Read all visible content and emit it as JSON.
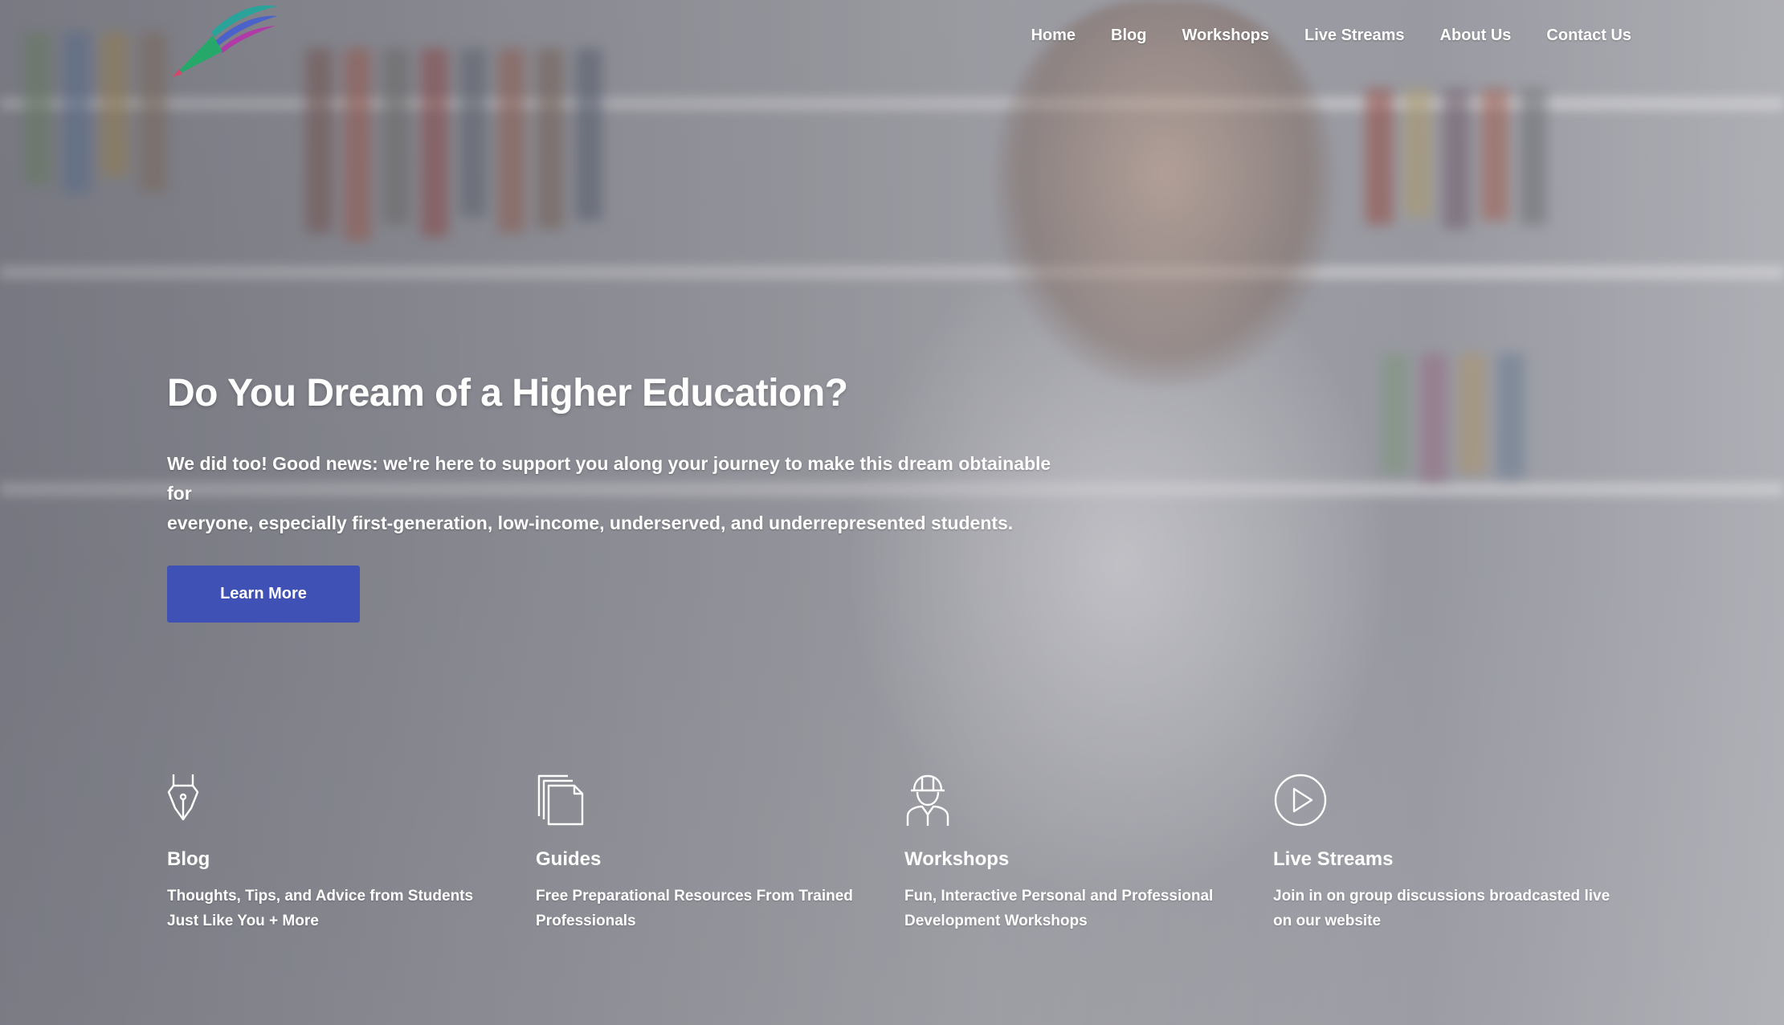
{
  "nav": {
    "items": [
      {
        "label": "Home"
      },
      {
        "label": "Blog"
      },
      {
        "label": "Workshops"
      },
      {
        "label": "Live Streams"
      },
      {
        "label": "About Us"
      },
      {
        "label": "Contact Us"
      }
    ]
  },
  "hero": {
    "title": "Do You Dream of a Higher Education?",
    "text_before": "We did too! Good news: we're here to support you along your journey to make this dream obtainable for",
    "text_emphasis": "everyone",
    "text_after": ", especially first-generation, low-income, underserved, and underrepresented students.",
    "cta_label": "Learn More",
    "cta_color": "#3f51b5"
  },
  "features": [
    {
      "icon": "fountain-pen-icon",
      "title": "Blog",
      "description": "Thoughts, Tips, and Advice from Students Just Like You + More"
    },
    {
      "icon": "documents-icon",
      "title": "Guides",
      "description": "Free Preparational Resources From Trained Professionals"
    },
    {
      "icon": "worker-hardhat-icon",
      "title": "Workshops",
      "description": "Fun, Interactive Personal and Professional Development Workshops"
    },
    {
      "icon": "play-circle-icon",
      "title": "Live Streams",
      "description": "Join in on group discussions broadcasted live on our website"
    }
  ]
}
